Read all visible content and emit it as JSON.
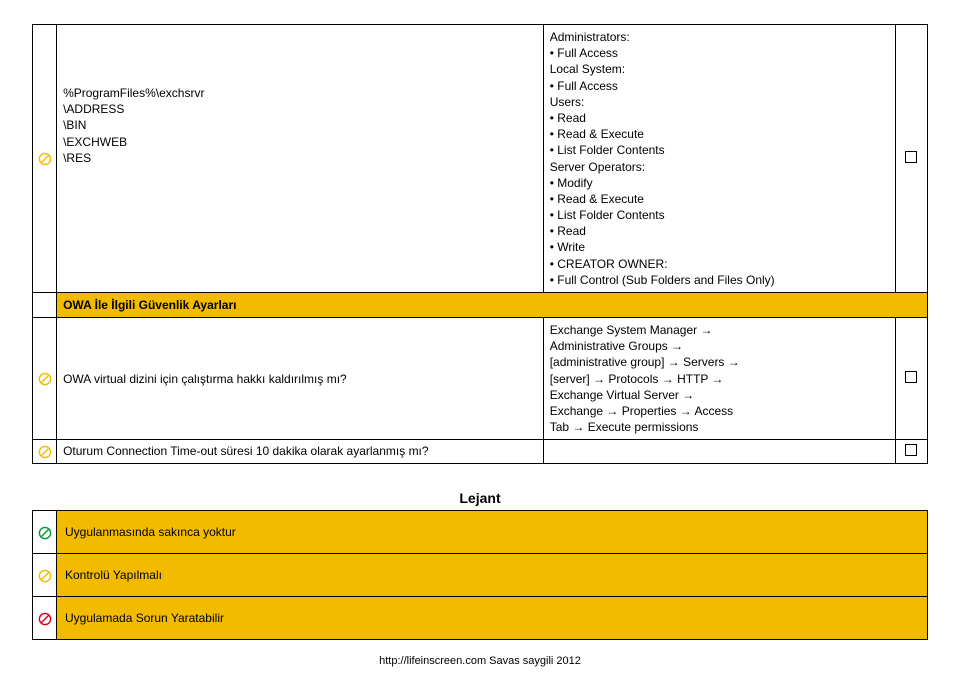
{
  "row1": {
    "icon_color": "#f2bb00",
    "left_lines": [
      "%ProgramFiles%\\exchsrvr",
      "\\ADDRESS",
      "\\BIN",
      "\\EXCHWEB",
      "\\RES"
    ],
    "mid_lines": [
      "Administrators:",
      "• Full Access",
      "Local System:",
      "• Full Access",
      "Users:",
      "• Read",
      "• Read & Execute",
      "• List Folder Contents",
      "Server Operators:",
      "• Modify",
      "• Read & Execute",
      "• List Folder Contents",
      "• Read",
      "• Write",
      "• CREATOR OWNER:",
      "• Full Control (Sub Folders and Files Only)"
    ]
  },
  "section_owa": "OWA İle İlgili Güvenlik Ayarları",
  "row2": {
    "icon_color": "#f2bb00",
    "left": "OWA virtual dizini için çalıştırma hakkı kaldırılmış mı?",
    "mid_lines": [
      "Exchange System Manager →",
      "Administrative Groups →",
      "[administrative group] → Servers →",
      "[server] → Protocols → HTTP →",
      "Exchange Virtual Server →",
      "Exchange → Properties → Access",
      "Tab → Execute permissions"
    ]
  },
  "row3": {
    "icon_color": "#f2bb00",
    "left": "Oturum Connection Time-out süresi 10 dakika olarak ayarlanmış mı?"
  },
  "legend": {
    "title": "Lejant",
    "rows": [
      {
        "icon_color": "#009933",
        "text": "Uygulanmasında sakınca yoktur"
      },
      {
        "icon_color": "#f2bb00",
        "text": "Kontrolü Yapılmalı"
      },
      {
        "icon_color": "#d4001c",
        "text": "Uygulamada Sorun Yaratabilir"
      }
    ]
  },
  "footer": "http://lifeinscreen.com Savas saygili 2012"
}
